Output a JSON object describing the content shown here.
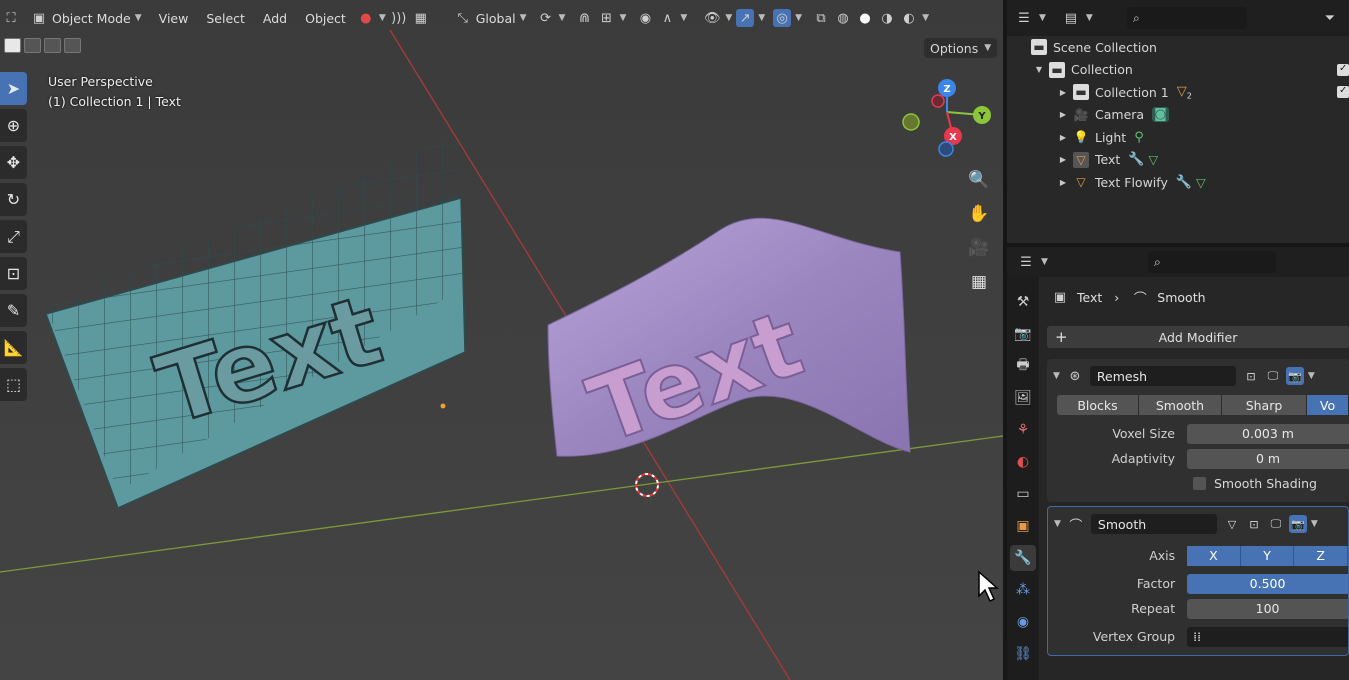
{
  "header": {
    "mode_label": "Object Mode",
    "menus": [
      "View",
      "Select",
      "Add",
      "Object"
    ],
    "transform_orientation": "Global",
    "options_label": "Options"
  },
  "viewport": {
    "view_name": "User Perspective",
    "collection_info": "(1) Collection 1 | Text",
    "left_plane_text": "Text",
    "right_plane_text": "Text",
    "gizmo": {
      "x": "X",
      "y": "Y",
      "z": "Z"
    }
  },
  "outliner": {
    "root": "Scene Collection",
    "collection": "Collection",
    "items": [
      {
        "label": "Collection 1",
        "icon": "collection-icon",
        "extra": "2"
      },
      {
        "label": "Camera",
        "icon": "camera-icon"
      },
      {
        "label": "Light",
        "icon": "light-icon"
      },
      {
        "label": "Text",
        "icon": "mesh-icon"
      },
      {
        "label": "Text Flowify",
        "icon": "mesh-icon"
      }
    ]
  },
  "properties": {
    "breadcrumb_object": "Text",
    "breadcrumb_modifier": "Smooth",
    "add_modifier_label": "Add Modifier",
    "remesh": {
      "name": "Remesh",
      "modes": [
        "Blocks",
        "Smooth",
        "Sharp",
        "Vo"
      ],
      "active_mode": "Vo",
      "voxel_size_label": "Voxel Size",
      "voxel_size_value": "0.003 m",
      "adaptivity_label": "Adaptivity",
      "adaptivity_value": "0 m",
      "smooth_shading_label": "Smooth Shading"
    },
    "smooth": {
      "name": "Smooth",
      "axis_label": "Axis",
      "axes": [
        "X",
        "Y",
        "Z"
      ],
      "factor_label": "Factor",
      "factor_value": "0.500",
      "repeat_label": "Repeat",
      "repeat_value": "100",
      "vertex_group_label": "Vertex Group"
    }
  },
  "colors": {
    "accent": "#4772b3",
    "viewport_bg": "#3d3d3d",
    "plane_left": "#5d9aa0",
    "plane_right": "#a48fc4",
    "axis_x_line": "#a83a3a",
    "axis_y_line": "#7d9a3a",
    "gizmo_x": "#e8384e",
    "gizmo_y": "#8bc63a",
    "gizmo_z": "#3b86e8"
  }
}
